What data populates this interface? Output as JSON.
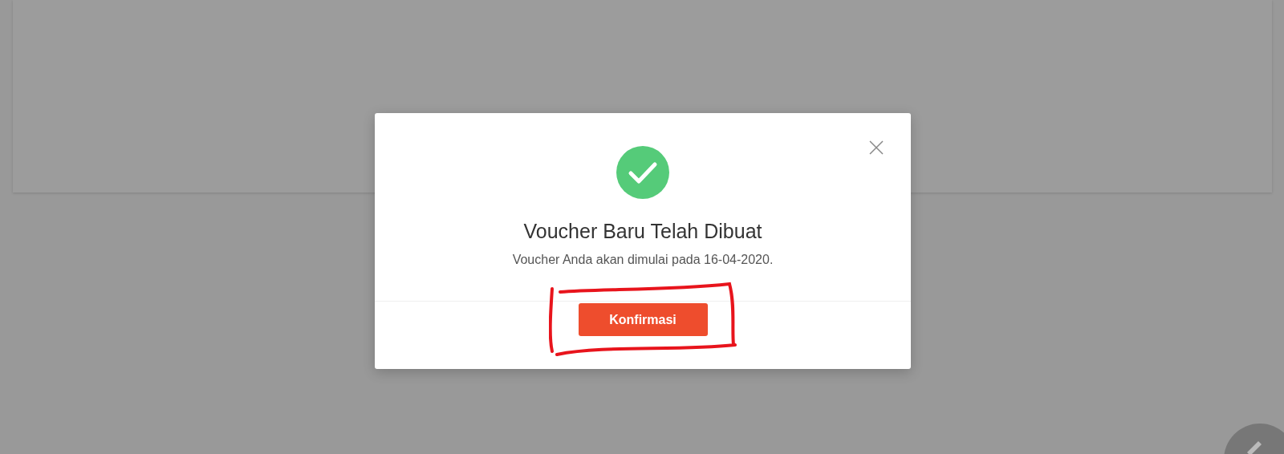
{
  "dialog": {
    "title": "Voucher Baru Telah Dibuat",
    "message": "Voucher Anda akan dimulai pada 16-04-2020.",
    "buttons": [
      "Konfirmasi"
    ]
  }
}
